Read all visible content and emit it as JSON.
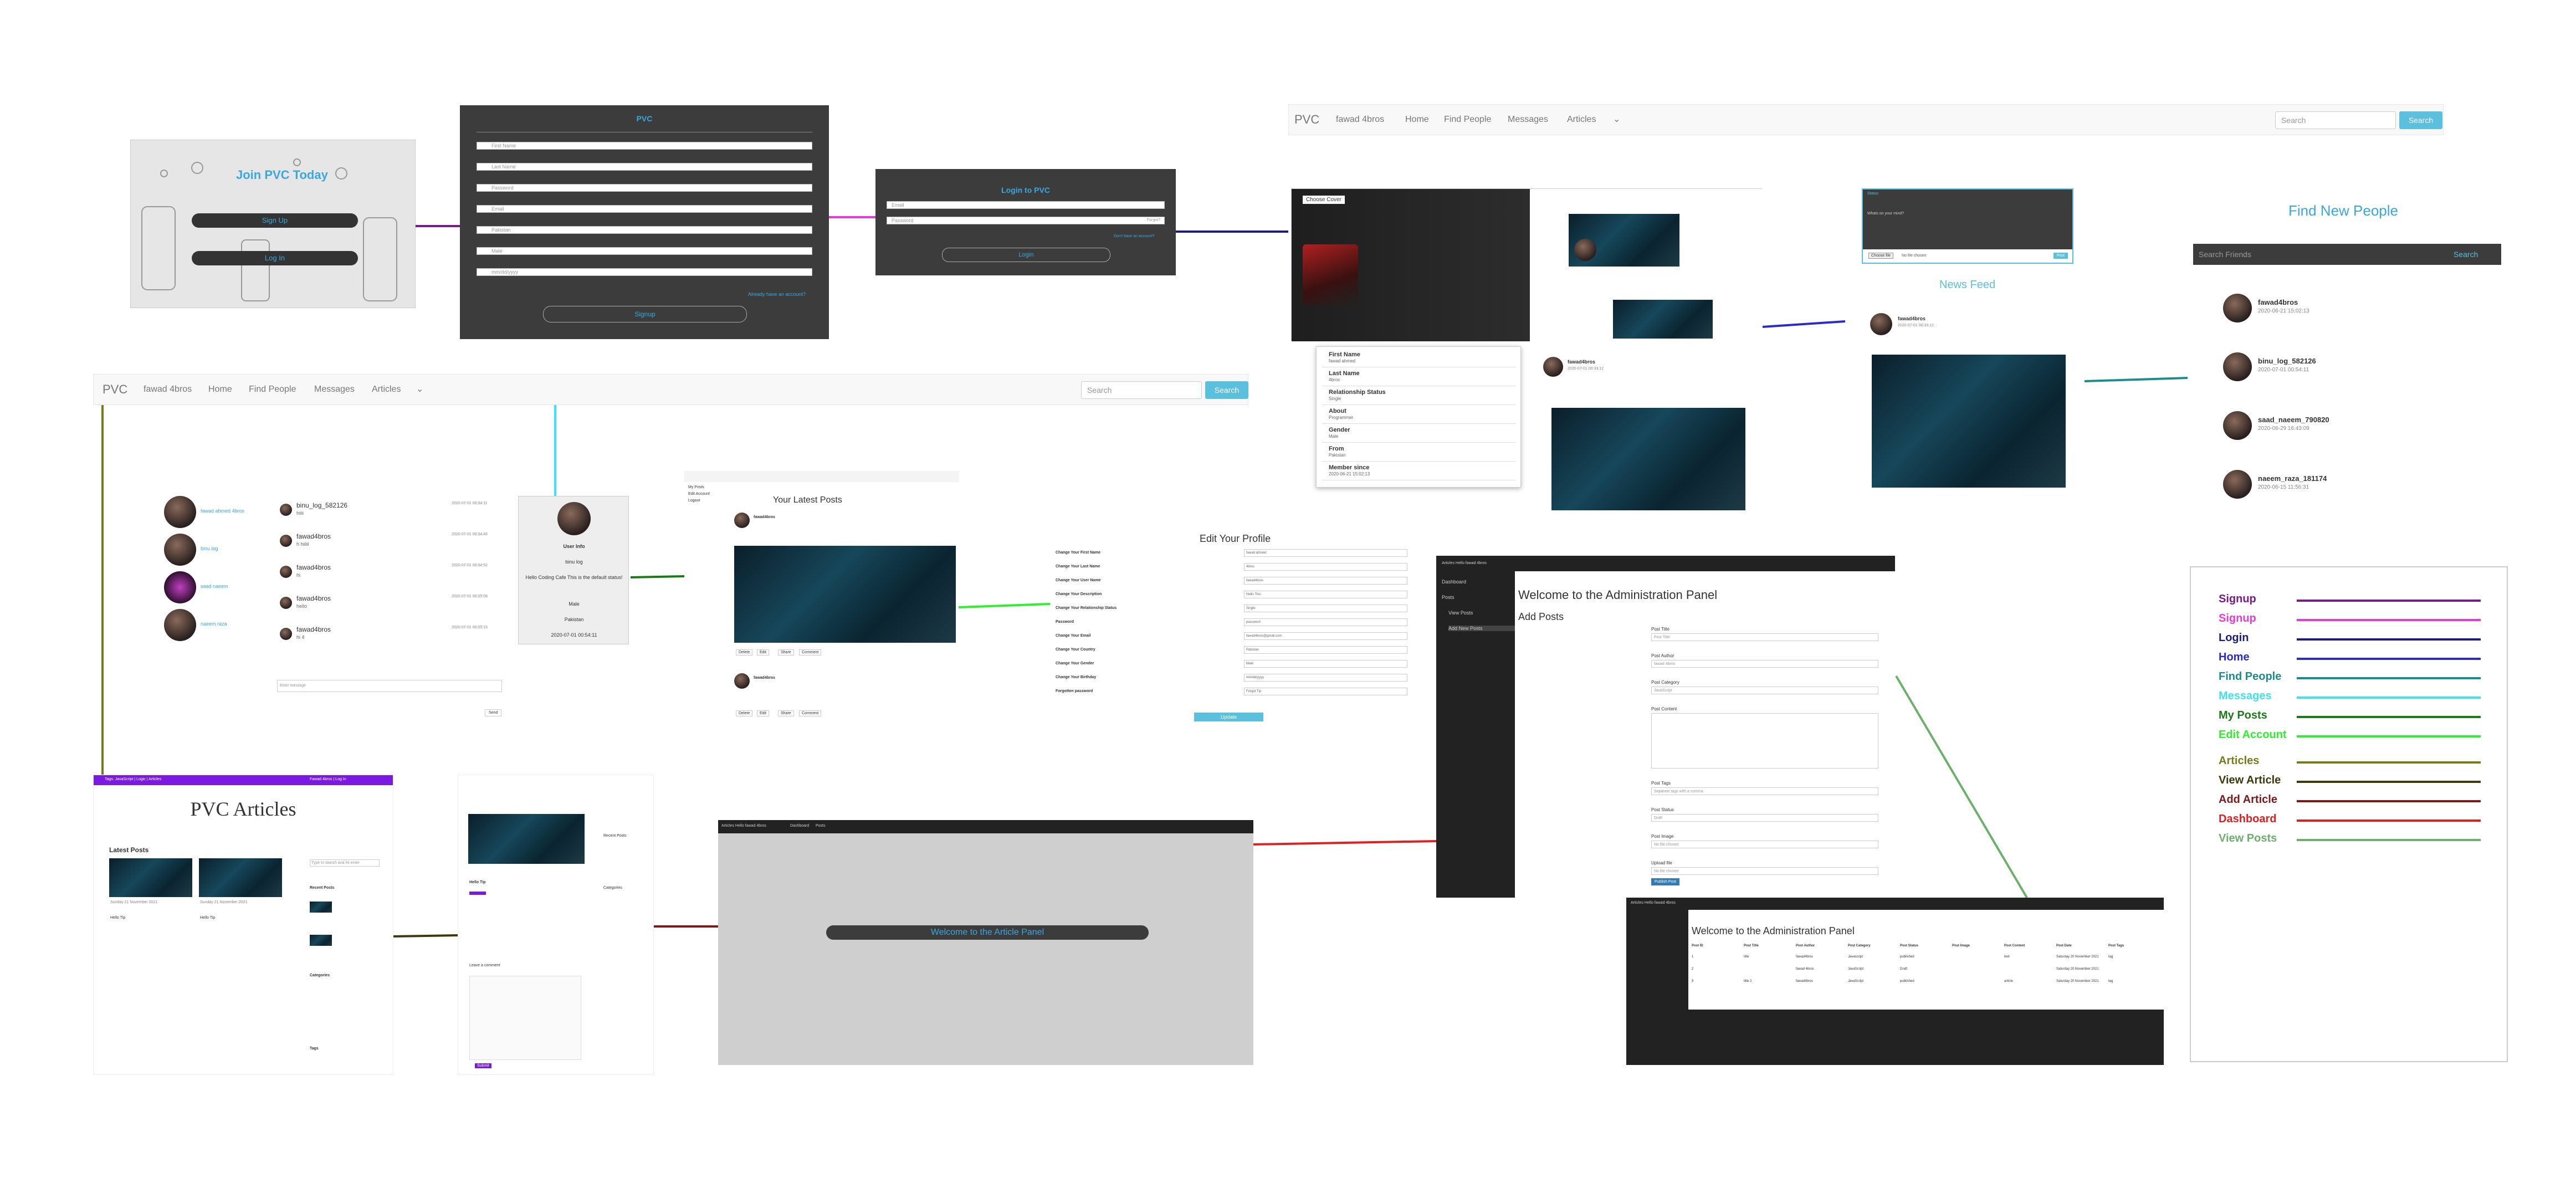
{
  "signup_card": {
    "headline": "Join PVC Today",
    "signup_btn": "Sign Up",
    "login_btn": "Log In"
  },
  "signup_form": {
    "title": "PVC",
    "fields": [
      "First Name",
      "Last Name",
      "Password",
      "Email",
      "Pakistan",
      "Male",
      "mm/dd/yyyy"
    ],
    "link": "Already have an account?",
    "submit": "Signup"
  },
  "login_form": {
    "title": "Login to PVC",
    "email": "Email",
    "password": "Password",
    "forgot": "Forgot?",
    "link": "Don't have an account?",
    "submit": "Login"
  },
  "nav_top": {
    "brand": "PVC",
    "user": "fawad 4bros",
    "home": "Home",
    "find": "Find People",
    "messages": "Messages",
    "articles": "Articles",
    "search_placeholder": "Search",
    "search_btn": "Search"
  },
  "nav_left": {
    "brand": "PVC",
    "user": "fawad 4bros",
    "home": "Home",
    "find": "Find People",
    "messages": "Messages",
    "articles": "Articles",
    "search_placeholder": "Search",
    "search_btn": "Search"
  },
  "profile_popup": {
    "choose_cover": "Choose Cover",
    "rows": [
      {
        "label": "First Name",
        "value": "fawad ahmed"
      },
      {
        "label": "Last Name",
        "value": "4bros"
      },
      {
        "label": "Relationship Status",
        "value": "Single"
      },
      {
        "label": "About",
        "value": "Programmer"
      },
      {
        "label": "Gender",
        "value": "Male"
      },
      {
        "label": "From",
        "value": "Pakistan"
      },
      {
        "label": "Member since",
        "value": "2020-06-21 15:02:13"
      }
    ],
    "post_user": "fawad4bros",
    "post_date": "2020-07-01 00:33:12"
  },
  "news_feed": {
    "status_label": "Status",
    "status_placeholder": "Whats on your mind?",
    "choose_file": "Choose file",
    "no_file": "No file chosen",
    "post_btn": "Post",
    "title": "News Feed",
    "post_user": "fawad4bros",
    "post_date": "2020-07-01 00:33:12"
  },
  "find_people": {
    "title": "Find New People",
    "search_placeholder": "Search Friends",
    "search_btn": "Search",
    "people": [
      {
        "name": "fawad4bros",
        "date": "2020-06-21 15:02:13"
      },
      {
        "name": "binu_log_582126",
        "date": "2020-07-01 00:54:11"
      },
      {
        "name": "saad_naeem_790820",
        "date": "2020-06-29 16:43:09"
      },
      {
        "name": "naeem_raza_181174",
        "date": "2020-06-15 11:56:31"
      }
    ]
  },
  "messages": {
    "contacts": [
      "fawad ahmed 4bros",
      "binu log",
      "saad naeem",
      "naeem raza"
    ],
    "threads": [
      {
        "name": "binu_log_582126",
        "text": "hiiii",
        "date": "2020-07-01 00:54:11"
      },
      {
        "name": "fawad4bros",
        "text": "h hiiiii",
        "date": "2020-07-01 00:54:46"
      },
      {
        "name": "fawad4bros",
        "text": "hi",
        "date": "2020-07-01 00:54:52"
      },
      {
        "name": "fawad4bros",
        "text": "hello",
        "date": "2020-07-01 00:55:08"
      },
      {
        "name": "fawad4bros",
        "text": "hi 4",
        "date": "2020-07-01 00:55:15"
      }
    ],
    "input_placeholder": "Enter message",
    "send_btn": "Send",
    "info": [
      "User Info",
      "binu log",
      "Hello Coding Cafe This is the default status!",
      "Male",
      "Pakistan",
      "2020-07-01 00:54:11"
    ]
  },
  "my_posts": {
    "title": "Your Latest Posts",
    "post_user": "fawad4bros",
    "actions": [
      "Delete",
      "Edit",
      "Share",
      "Comment"
    ],
    "menu": [
      "My Posts",
      "Edit Account",
      "Logout"
    ]
  },
  "edit_profile": {
    "title": "Edit Your Profile",
    "rows": [
      {
        "label": "Change Your First Name",
        "value": "fawad ahmed"
      },
      {
        "label": "Change Your Last Name",
        "value": "4bros"
      },
      {
        "label": "Change Your User Name",
        "value": "fawad4bros"
      },
      {
        "label": "Change Your Description",
        "value": "Hello This"
      },
      {
        "label": "Change Your Relationship Status",
        "value": "Single"
      },
      {
        "label": "Password",
        "value": "password"
      },
      {
        "label": "Change Your Email",
        "value": "fawad4bros@gmail.com"
      },
      {
        "label": "Change Your Country",
        "value": "Pakistan"
      },
      {
        "label": "Change Your Gender",
        "value": "Male"
      },
      {
        "label": "Change Your Birthday",
        "value": "mm/dd/yyyy"
      },
      {
        "label": "Forgotten password",
        "value": "Forgot Tip"
      }
    ],
    "update_btn": "Update"
  },
  "admin": {
    "header": "Articles Hello fawad 4bros",
    "menu": [
      "Dashboard",
      "Posts",
      "View Posts",
      "Add New Posts"
    ],
    "welcome": "Welcome to the Administration Panel",
    "section": "Add Posts",
    "fields": [
      {
        "label": "Post Title",
        "value": "Post Title"
      },
      {
        "label": "Post Author",
        "value": "fawad 4bros"
      },
      {
        "label": "Post Category",
        "value": "JavaScript"
      },
      {
        "label": "Post Content",
        "value": ""
      },
      {
        "label": "Post Tags",
        "value": "Separate tags with a comma"
      },
      {
        "label": "Post Status",
        "value": "Draft"
      },
      {
        "label": "Post Image",
        "value": "No file chosen"
      },
      {
        "label": "Upload file",
        "value": "No file chosen"
      }
    ],
    "publish_btn": "Publish Post"
  },
  "admin_view": {
    "header": "Articles Hello fawad 4bros",
    "welcome": "Welcome to the Administration Panel",
    "columns": [
      "Post ID",
      "Post Title",
      "Post Author",
      "Post Category",
      "Post Status",
      "Post Image",
      "Post Content",
      "Post Date",
      "Post Tags"
    ],
    "rows": [
      [
        "1",
        "title",
        "fawad4bros",
        "Javascript",
        "published",
        "",
        "text",
        "Saturday 20 November 2021",
        "tag"
      ],
      [
        "2",
        "",
        "fawad 4bros",
        "JavaScript",
        "Draft",
        "",
        "",
        "Saturday 20 November 2021",
        ""
      ],
      [
        "3",
        "title 2",
        "fawad4bros",
        "JavaScript",
        "published",
        "",
        "article",
        "Saturday 20 November 2021",
        "tag"
      ]
    ]
  },
  "articles": {
    "banner_left": "Tags: JavaScript | Logic | Articles",
    "banner_right": "Fawad 4bros | Log In",
    "title": "PVC Articles",
    "latest": "Latest Posts",
    "post_caption": "Sunday 21 November 2021",
    "post_title": "Hello Tip",
    "search_placeholder": "Type to search and hit enter",
    "recent_posts": "Recent Posts",
    "categories": "Categories",
    "tags": "Tags"
  },
  "article_view": {
    "title": "Hello Tip",
    "leave_comment": "Leave a comment",
    "recent_posts": "Recent Posts",
    "categories": "Categories",
    "submit": "Submit"
  },
  "article_admin": {
    "header": "Articles Hello fawad 4bros",
    "tabs": [
      "Dashboard",
      "Posts"
    ],
    "welcome": "Welcome to the Article Panel"
  },
  "legend": {
    "items": [
      {
        "label": "Signup",
        "color": "#7a1a8a"
      },
      {
        "label": "Signup",
        "color": "#e53ad6"
      },
      {
        "label": "Login",
        "color": "#1c1c7a"
      },
      {
        "label": "Home",
        "color": "#2a2acf"
      },
      {
        "label": "Find People",
        "color": "#1e8c8c"
      },
      {
        "label": "Messages",
        "color": "#3ce3f0"
      },
      {
        "label": "My Posts",
        "color": "#1a7a1a"
      },
      {
        "label": "Edit Account",
        "color": "#2ef02e"
      },
      {
        "label": "Articles",
        "color": "#7a7a1a"
      },
      {
        "label": "View Article",
        "color": "#3a3a0a"
      },
      {
        "label": "Add Article",
        "color": "#7a1a1a"
      },
      {
        "label": "Dashboard",
        "color": "#e02020"
      },
      {
        "label": "View Posts",
        "color": "#6cb06c"
      }
    ]
  }
}
